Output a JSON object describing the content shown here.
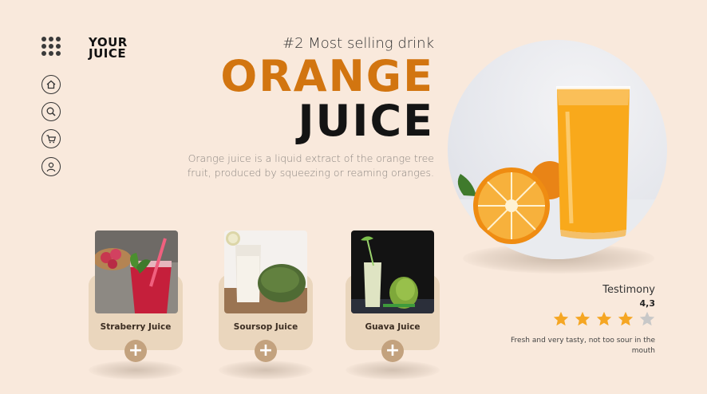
{
  "brand": {
    "line1": "YOUR",
    "line2": "JUICE"
  },
  "nav": [
    {
      "name": "home-icon"
    },
    {
      "name": "search-icon"
    },
    {
      "name": "cart-icon"
    },
    {
      "name": "user-icon"
    }
  ],
  "hero": {
    "subtitle": "#2 Most selling drink",
    "title_line1": "ORANGE",
    "title_line2": "JUICE",
    "description": "Orange juice is a liquid extract of the orange tree fruit, produced by squeezing or reaming oranges."
  },
  "products": [
    {
      "name": "Straberry Juice",
      "add_label": "+"
    },
    {
      "name": "Soursop Juice",
      "add_label": "+"
    },
    {
      "name": "Guava Juice",
      "add_label": "+"
    }
  ],
  "testimony": {
    "title": "Testimony",
    "score": "4,3",
    "stars_filled": 4,
    "stars_total": 5,
    "text": "Fresh and very tasty, not too sour in the mouth"
  },
  "colors": {
    "background": "#f9e9dc",
    "accent_orange": "#d27510",
    "card": "#ead6bd",
    "button": "#c3a27e",
    "star_filled": "#f5a623",
    "star_empty": "#c8c8c8"
  }
}
